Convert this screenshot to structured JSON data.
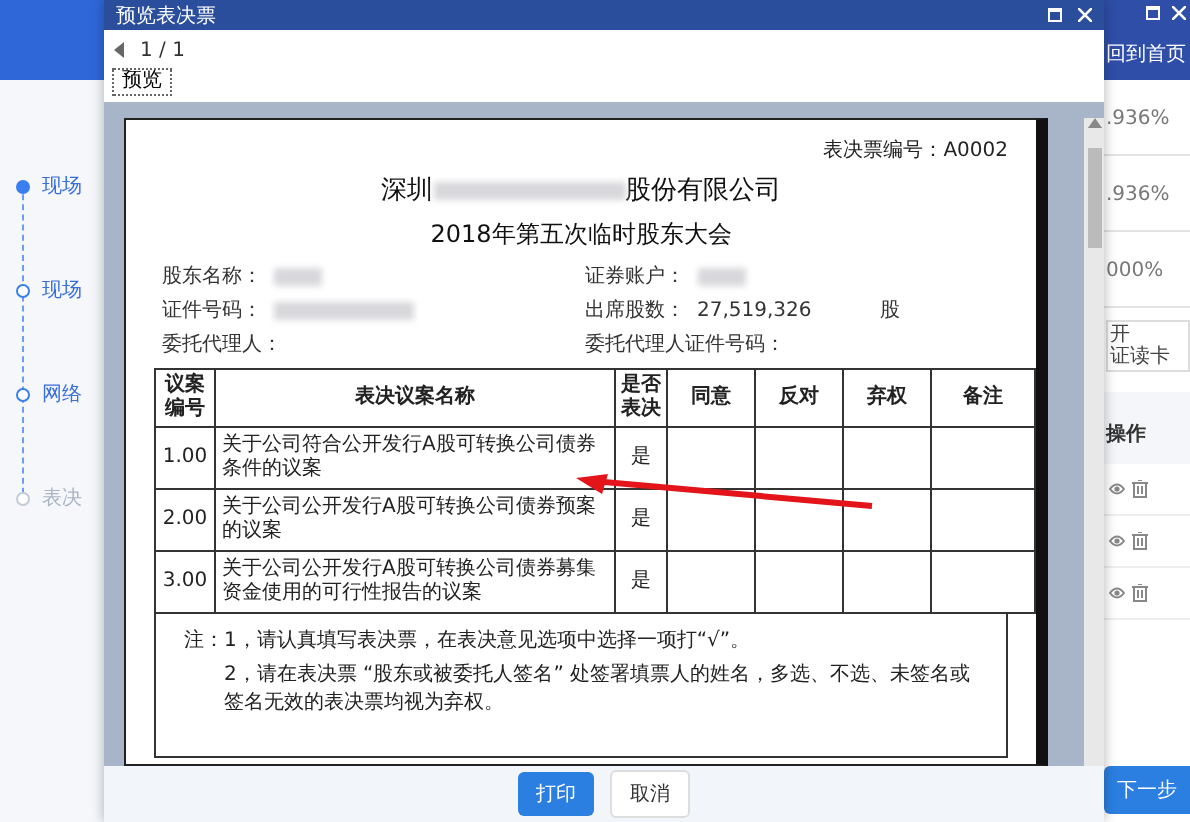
{
  "app": {
    "home_button": "回到首页",
    "steps": [
      {
        "label": "现场",
        "selected": true,
        "disabled": false
      },
      {
        "label": "现场",
        "selected": false,
        "disabled": false
      },
      {
        "label": "网络",
        "selected": false,
        "disabled": false
      },
      {
        "label": "表决",
        "selected": false,
        "disabled": true
      }
    ],
    "stats": [
      ".936%",
      ".936%",
      "000%"
    ],
    "card_button": [
      "开",
      "证读卡"
    ],
    "actions_header": "操作",
    "next_button": "下一步"
  },
  "dialog": {
    "title": "预览表决票",
    "page": "1 / 1",
    "preview_button": "预览",
    "paper": {
      "ticket_no": "表决票编号：A0002",
      "company_prefix": "深圳",
      "company_redacted": true,
      "company_suffix": "股份有限公司",
      "meeting": "2018年第五次临时股东大会",
      "fields_left": [
        {
          "label": "股东名称：",
          "redacted": true
        },
        {
          "label": "证件号码：",
          "redacted": true
        },
        {
          "label": "委托代理人：",
          "redacted": false
        }
      ],
      "fields_right": [
        {
          "label": "证券账户：",
          "redacted": true
        },
        {
          "label": "出席股数：",
          "redacted": false,
          "value": "27,519,326",
          "unit": "股"
        },
        {
          "label": "委托代理人证件号码：",
          "redacted": false
        }
      ],
      "columns": [
        "议案编号",
        "表决议案名称",
        "是否表决",
        "同意",
        "反对",
        "弃权",
        "备注"
      ],
      "rows": [
        {
          "number": "1.00",
          "name": "关于公司符合公开发行A股可转换公司债券条件的议案",
          "vote": "是"
        },
        {
          "number": "2.00",
          "name": "关于公司公开发行A股可转换公司债券预案的议案",
          "vote": "是"
        },
        {
          "number": "3.00",
          "name": "关于公司公开发行A股可转换公司债券募集资金使用的可行性报告的议案",
          "vote": "是"
        }
      ],
      "notes": [
        "注：1，请认真填写表决票，在表决意见选项中选择一项打“√”。",
        "2，请在表决票 “股东或被委托人签名” 处签署填票人的姓名，多选、不选、未签名或签名无效的表决票均视为弃权。"
      ]
    },
    "print_button": "打印",
    "cancel_button": "取消"
  }
}
